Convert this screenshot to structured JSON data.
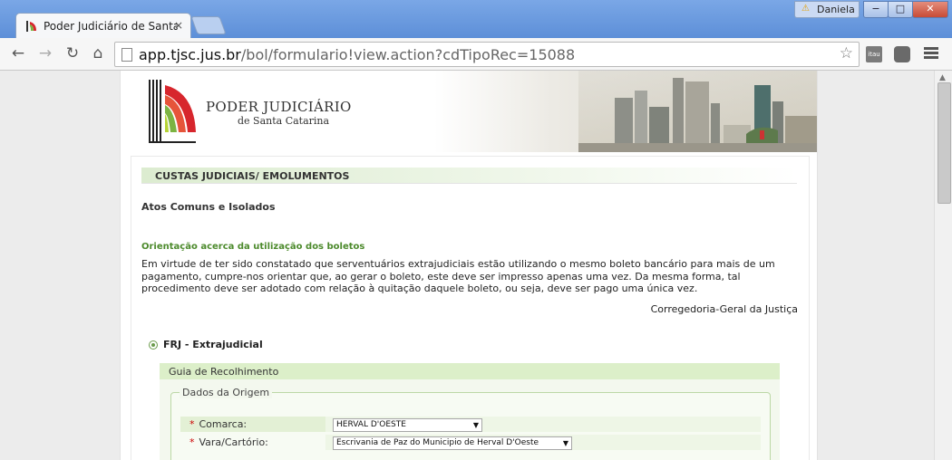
{
  "browser": {
    "tab_title": "Poder Judiciário de Santa",
    "tab_close": "×",
    "user": "Daniela",
    "warning_glyph": "⚠",
    "url_host": "app.tjsc.jus.br",
    "url_path": "/bol/formulario!view.action?cdTipoRec=15088",
    "ext_itau": "itau",
    "nav": {
      "back": "←",
      "forward": "→",
      "reload": "↻",
      "home": "⌂"
    },
    "window_controls": {
      "minimize": "−",
      "maximize": "□",
      "close": "✕"
    }
  },
  "header": {
    "logo_title": "PODER JUDICIÁRIO",
    "logo_subtitle": "de Santa Catarina"
  },
  "section": {
    "title": "CUSTAS JUDICIAIS/ EMOLUMENTOS",
    "acts_title": "Atos Comuns e Isolados",
    "orientation_title": "Orientação acerca da utilização dos boletos",
    "orientation_body": "Em virtude de ter sido constatado que serventuários extrajudiciais estão utilizando o mesmo boleto bancário para mais de um pagamento, cumpre-nos orientar que, ao gerar o boleto, este deve ser impresso apenas uma vez. Da mesma forma, tal procedimento deve ser adotado com relação à quitação daquele boleto, ou seja, deve ser pago uma única vez.",
    "signature": "Corregedoria-Geral da Justiça"
  },
  "frj": {
    "label": "FRJ - Extrajudicial"
  },
  "guia": {
    "title": "Guia de Recolhimento",
    "fieldset_legend": "Dados da Origem",
    "required_mark": "*",
    "fields": [
      {
        "label": "Comarca:",
        "value": "HERVAL D'OESTE"
      },
      {
        "label": "Vara/Cartório:",
        "value": "Escrivania de Paz do Municipio de Herval D'Oeste"
      }
    ],
    "select_arrow": "▼"
  },
  "colors": {
    "accent_green": "#4c8a2c",
    "header_green": "#dcefc9",
    "logo_red": "#d7262d",
    "logo_green": "#7cb342",
    "required_red": "#cc0000"
  }
}
